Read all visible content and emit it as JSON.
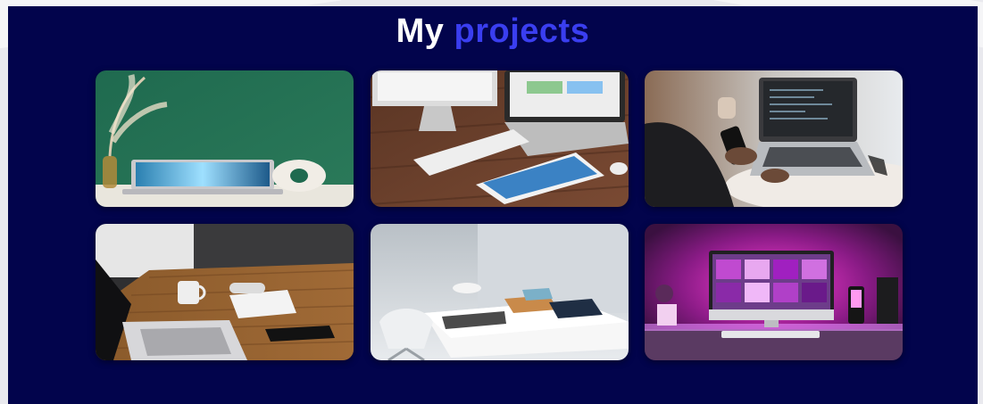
{
  "heading": {
    "word1": "My",
    "word2": "projects"
  },
  "projects": [
    {
      "name": "laptop-with-pampas-grass"
    },
    {
      "name": "imac-macbook-ipad-desk"
    },
    {
      "name": "person-using-phone-and-laptop"
    },
    {
      "name": "laptop-notebook-wooden-desk"
    },
    {
      "name": "white-desk-with-tablets"
    },
    {
      "name": "neon-pink-imac-setup"
    }
  ],
  "colors": {
    "section_bg": "#02044c",
    "heading_primary": "#ffffff",
    "heading_accent": "#3a3ef0"
  }
}
